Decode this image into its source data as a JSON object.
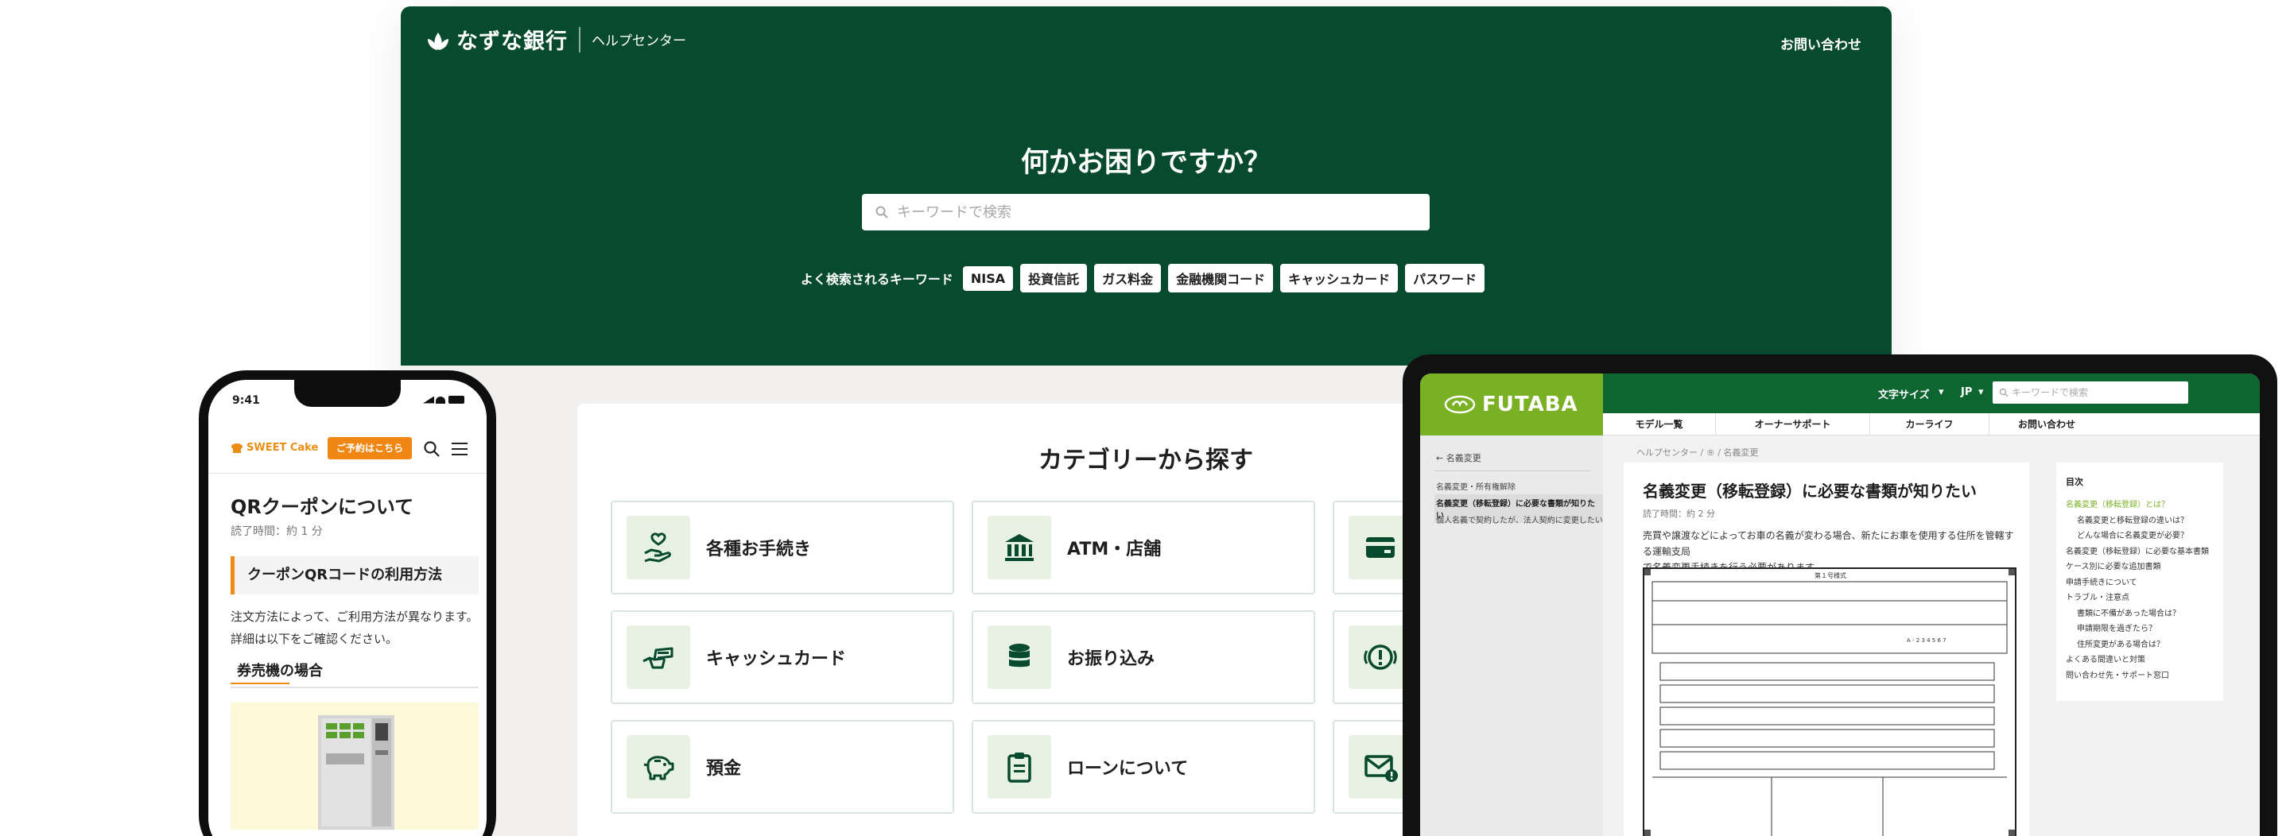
{
  "colors": {
    "bank_green": "#074a2e",
    "category_icon_bg": "#e8f2e3",
    "sweet_orange": "#f08714",
    "futaba_lime": "#7ab024",
    "futaba_green": "#0d6530"
  },
  "desktop": {
    "brand": "なずな銀行",
    "subtitle": "ヘルプセンター",
    "contact": "お問い合わせ",
    "hero_title": "何かお困りですか？",
    "search_placeholder": "キーワードで検索",
    "keywords_label": "よく検索されるキーワード",
    "keywords": [
      "NISA",
      "投資信託",
      "ガス料金",
      "金融機関コード",
      "キャッシュカード",
      "パスワード"
    ],
    "categories_title": "カテゴリーから探す",
    "categories": [
      {
        "label": "各種お手続き",
        "icon": "hand-heart-icon"
      },
      {
        "label": "ATM・店舗",
        "icon": "bank-icon"
      },
      {
        "label": "",
        "icon": "credit-card-icon"
      },
      {
        "label": "キャッシュカード",
        "icon": "card-insert-icon"
      },
      {
        "label": "お振り込み",
        "icon": "coins-icon"
      },
      {
        "label": "",
        "icon": "alert-icon"
      },
      {
        "label": "預金",
        "icon": "piggy-bank-icon"
      },
      {
        "label": "ローンについて",
        "icon": "clipboard-icon"
      },
      {
        "label": "",
        "icon": "mail-alert-icon"
      }
    ]
  },
  "phone": {
    "time": "9:41",
    "brand": "SWEET Cake",
    "reserve_button": "ご予約はこちら",
    "title": "QRクーポンについて",
    "read_time": "読了時間：約 1 分",
    "heading": "クーポンQRコードの利用方法",
    "body_lines": [
      "注文方法によって、ご利用方法が異なります。",
      "詳細は以下をご確認ください。"
    ],
    "subheading": "券売機の場合"
  },
  "tablet": {
    "brand": "FUTABA",
    "font_size": "文字サイズ",
    "language": "JP",
    "search_placeholder": "キーワードで検索",
    "nav": [
      "モデル一覧",
      "オーナーサポート",
      "カーライフ",
      "お問い合わせ"
    ],
    "sidebar_back": "名義変更",
    "sidebar_items": [
      "名義変更・所有権解除",
      "名義変更（移転登録）に必要な書類が知りたい",
      "個人名義で契約したが、法人契約に変更したい"
    ],
    "breadcrumb": "ヘルプセンター / ® / 名義変更",
    "article_title": "名義変更（移転登録）に必要な書類が知りたい",
    "read_time": "読了時間：約 2 分",
    "description": [
      "売買や譲渡などによってお車の名義が変わる場合、新たにお車を使用する住所を管轄する運輸支局",
      "で名義変更手続きを行う必要があります。"
    ],
    "toc_title": "目次",
    "toc": [
      {
        "text": "名義変更（移転登録）とは？",
        "level": 1
      },
      {
        "text": "名義変更と移転登録の違いは？",
        "level": 2
      },
      {
        "text": "どんな場合に名義変更が必要？",
        "level": 2
      },
      {
        "text": "名義変更（移転登録）に必要な基本書類",
        "level": 1
      },
      {
        "text": "ケース別に必要な追加書類",
        "level": 1
      },
      {
        "text": "申請手続きについて",
        "level": 1
      },
      {
        "text": "トラブル・注意点",
        "level": 1
      },
      {
        "text": "書類に不備があった場合は？",
        "level": 2
      },
      {
        "text": "申請期限を過ぎたら？",
        "level": 2
      },
      {
        "text": "住所変更がある場合は？",
        "level": 2
      },
      {
        "text": "よくある間違いと対策",
        "level": 1
      },
      {
        "text": "問い合わせ先・サポート窓口",
        "level": 1
      }
    ],
    "form_title": "第１号様式",
    "form_stamp": "A - 2 3 4 5 6 7"
  }
}
